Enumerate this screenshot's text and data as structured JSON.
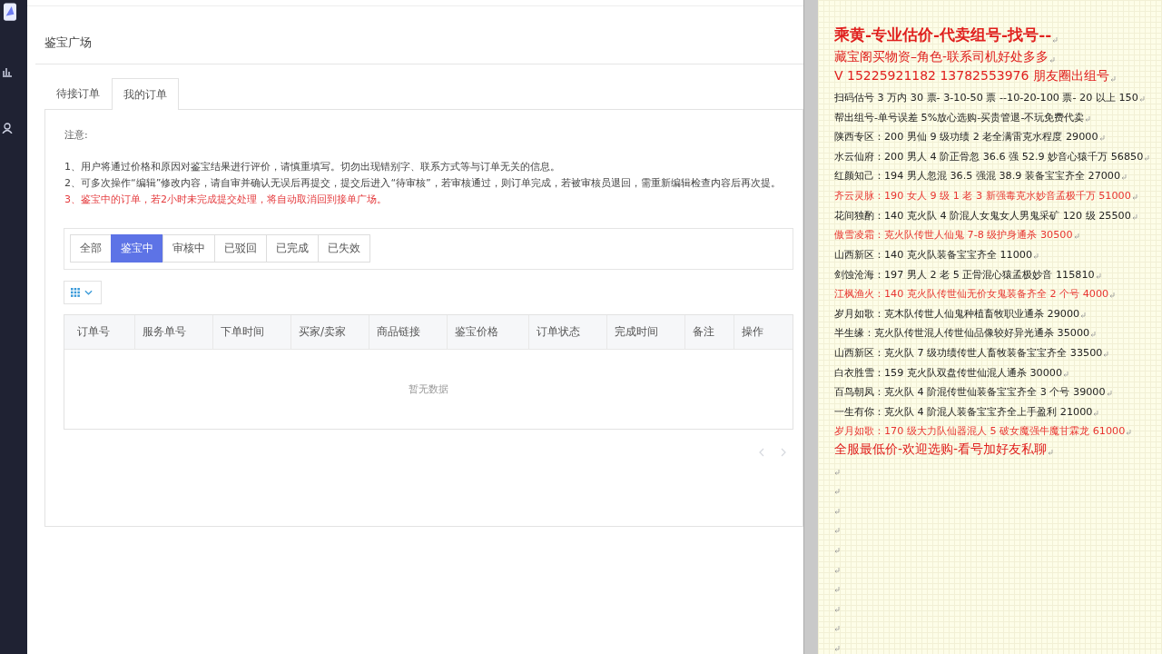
{
  "page_title": "鉴宝广场",
  "tabs": [
    {
      "label": "待接订单",
      "selected": false
    },
    {
      "label": "我的订单",
      "selected": true
    }
  ],
  "notice": {
    "heading": "注意:",
    "items": [
      {
        "text": "1、用户将通过价格和原因对鉴宝结果进行评价，请慎重填写。切勿出现错别字、联系方式等与订单无关的信息。",
        "kind": "normal"
      },
      {
        "text": "2、可多次操作“编辑”修改内容，请自审并确认无误后再提交，提交后进入“待审核”，若审核通过，则订单完成，若被审核员退回，需重新编辑检查内容后再次提。",
        "kind": "normal"
      },
      {
        "text": "3、鉴宝中的订单，若2小时未完成提交处理，将自动取消回到接单广场。",
        "kind": "warning"
      }
    ]
  },
  "filters": [
    {
      "label": "全部",
      "selected": false
    },
    {
      "label": "鉴宝中",
      "selected": true
    },
    {
      "label": "审核中",
      "selected": false
    },
    {
      "label": "已驳回",
      "selected": false
    },
    {
      "label": "已完成",
      "selected": false
    },
    {
      "label": "已失效",
      "selected": false
    }
  ],
  "table": {
    "columns": [
      "订单号",
      "服务单号",
      "下单时间",
      "买家/卖家",
      "商品链接",
      "鉴宝价格",
      "订单状态",
      "完成时间",
      "备注",
      "操作"
    ],
    "empty_text": "暂无数据"
  },
  "document_lines": [
    {
      "text": "乘黄-专业估价-代卖组号-找号--",
      "kind": "heading"
    },
    {
      "text": "藏宝阁买物资–角色-联系司机好处多多",
      "kind": "large-red"
    },
    {
      "text": "V 15225921182   13782553976 朋友圈出组号",
      "kind": "large-red"
    },
    {
      "text": "扫码估号 3 万内 30 票- 3-10-50 票  --10-20-100 票- 20 以上 150",
      "kind": "plain"
    },
    {
      "text": "帮出组号-单号误差 5%放心选购-买贵管退-不玩免费代卖",
      "kind": "plain"
    },
    {
      "text": "陕西专区：200 男仙 9 级功绩 2 老全满雷克水程度 29000",
      "kind": "plain"
    },
    {
      "text": "水云仙府：200 男人 4 阶正骨忽 36.6 强 52.9 妙音心猿千万 56850",
      "kind": "plain"
    },
    {
      "text": "红颜知己：194 男人忽混 36.5 强混 38.9 装备宝宝齐全 27000",
      "kind": "plain"
    },
    {
      "text": "齐云灵脉：190 女人 9 级 1 老 3 新强毒克水妙音孟极千万 51000",
      "kind": "red"
    },
    {
      "text": "花间独酌：140 克火队 4 阶混人女鬼女人男鬼采矿 120 级 25500",
      "kind": "plain"
    },
    {
      "text": "傲雪凌霜：克火队传世人仙鬼 7-8 级护身通杀 30500",
      "kind": "red"
    },
    {
      "text": "山西新区：140 克火队装备宝宝齐全 11000",
      "kind": "plain"
    },
    {
      "text": "剑蚀沧海：197 男人 2 老 5 正骨混心猿孟极妙音 115810",
      "kind": "plain"
    },
    {
      "text": "江枫渔火：140 克火队传世仙无价女鬼装备齐全 2 个号 4000",
      "kind": "red"
    },
    {
      "text": "岁月如歌：克木队传世人仙鬼种植畜牧职业通杀 29000",
      "kind": "plain"
    },
    {
      "text": "半生缘：克火队传世混人传世仙品像较好异光通杀 35000",
      "kind": "plain"
    },
    {
      "text": "山西新区：克火队 7 级功绩传世人畜牧装备宝宝齐全 33500",
      "kind": "plain"
    },
    {
      "text": "白衣胜雪：159 克火队双盘传世仙混人通杀 30000",
      "kind": "plain"
    },
    {
      "text": "百鸟朝凤：克火队 4 阶混传世仙装备宝宝齐全 3 个号 39000",
      "kind": "plain"
    },
    {
      "text": "一生有你：克火队 4 阶混人装备宝宝齐全上手盈利 21000",
      "kind": "plain"
    },
    {
      "text": "岁月如歌：170 级大力队仙器混人 5 破女魔强牛魔甘霖龙 61000",
      "kind": "red"
    },
    {
      "text": "全服最低价-欢迎选购-看号加好友私聊",
      "kind": "large-red"
    }
  ]
}
